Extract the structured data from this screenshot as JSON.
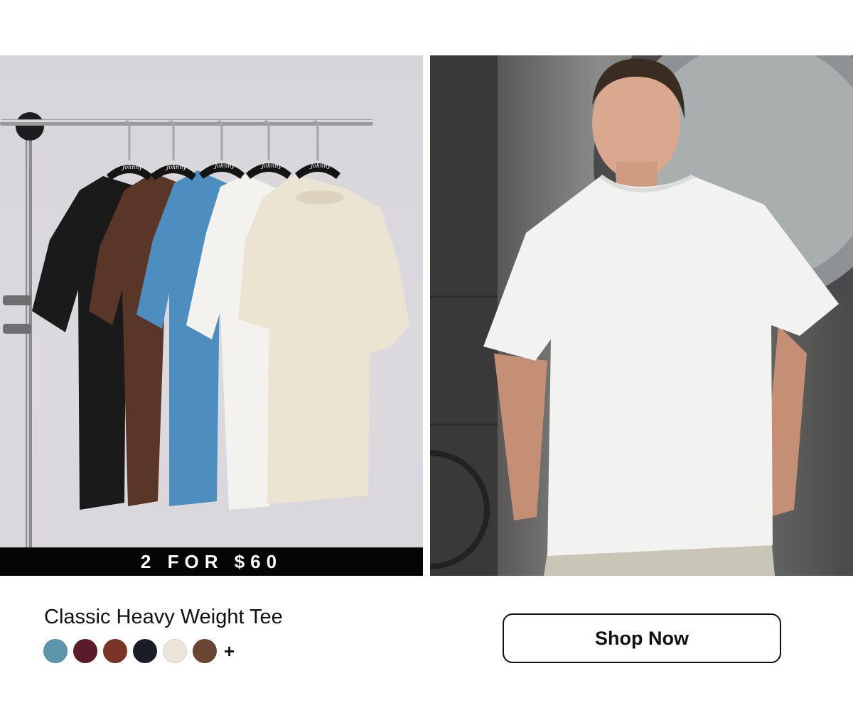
{
  "promo": {
    "text": "2 FOR $60"
  },
  "product": {
    "title": "Classic Heavy Weight Tee",
    "swatches": [
      {
        "name": "blue",
        "color": "#5b96ad"
      },
      {
        "name": "burgundy",
        "color": "#5a1b2a"
      },
      {
        "name": "rust-brown",
        "color": "#7a3428"
      },
      {
        "name": "navy-black",
        "color": "#1b1d26"
      },
      {
        "name": "cream",
        "color": "#ebe5dc"
      },
      {
        "name": "brown",
        "color": "#6b4534"
      }
    ],
    "more_label": "+"
  },
  "cta": {
    "label": "Shop Now"
  },
  "hangers": {
    "label": "Johnny"
  },
  "colors": {
    "tee_black": "#1a1a1a",
    "tee_brown": "#5a3628",
    "tee_blue": "#4e8dc0",
    "tee_white": "#f3f2ef",
    "tee_cream": "#ece4d2"
  }
}
